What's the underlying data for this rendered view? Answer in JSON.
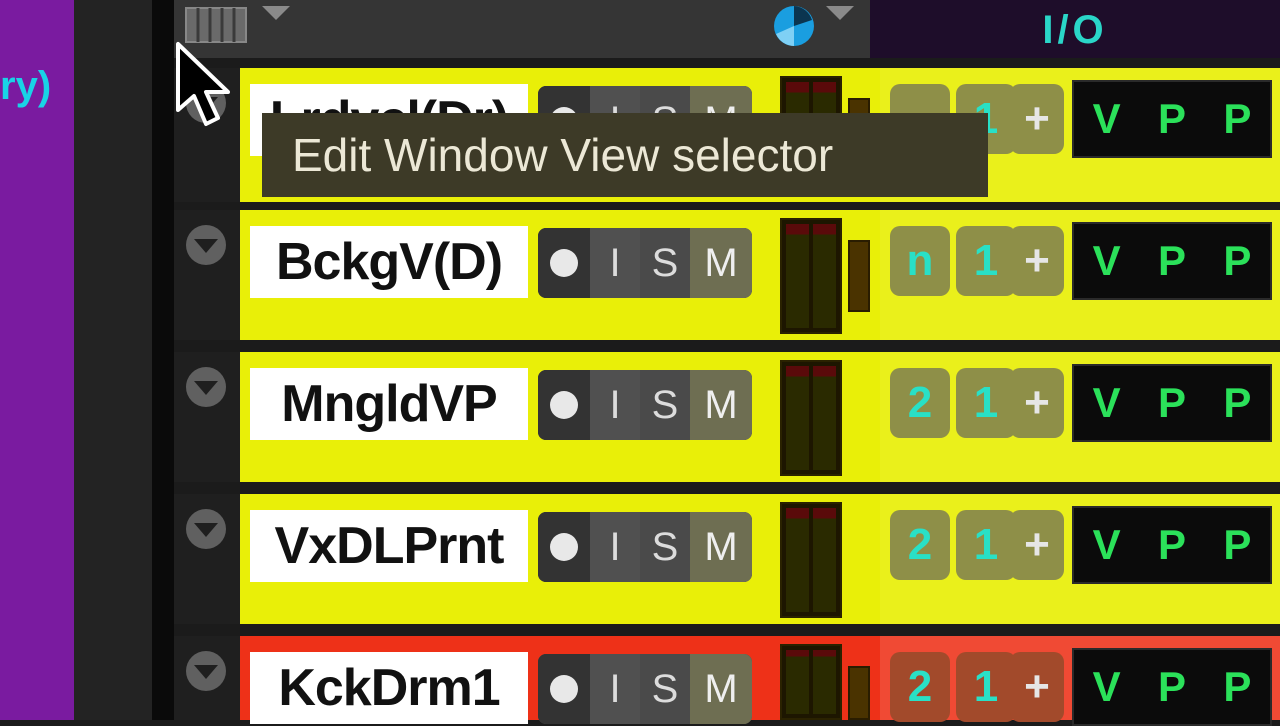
{
  "sidebar": {
    "partial_text": "ry)"
  },
  "header": {
    "io_label": "I/O"
  },
  "tooltip": {
    "text": "Edit Window View selector"
  },
  "track_buttons": {
    "input": "I",
    "solo": "S",
    "mute": "M"
  },
  "tracks": [
    {
      "name": "Lrdvcl(Dr)",
      "color": "#e9ef08",
      "io": [
        "",
        "1",
        "+"
      ],
      "vpp": [
        "V",
        "P",
        "P"
      ]
    },
    {
      "name": "BckgV(D)",
      "color": "#e9ef08",
      "io": [
        "n",
        "1",
        "+"
      ],
      "vpp": [
        "V",
        "P",
        "P"
      ]
    },
    {
      "name": "MngldVP",
      "color": "#e9ef08",
      "io": [
        "2",
        "1",
        "+"
      ],
      "vpp": [
        "V",
        "P",
        "P"
      ]
    },
    {
      "name": "VxDLPrnt",
      "color": "#e9ef08",
      "io": [
        "2",
        "1",
        "+"
      ],
      "vpp": [
        "V",
        "P",
        "P"
      ]
    },
    {
      "name": "KckDrm1",
      "color": "#ee3118",
      "io": [
        "2",
        "1",
        "+"
      ],
      "vpp": [
        "V",
        "P",
        "P"
      ]
    }
  ],
  "colors": {
    "accent_cyan": "#2ad6c8",
    "vpp_green": "#2be15a",
    "purple": "#7a1ba0"
  }
}
